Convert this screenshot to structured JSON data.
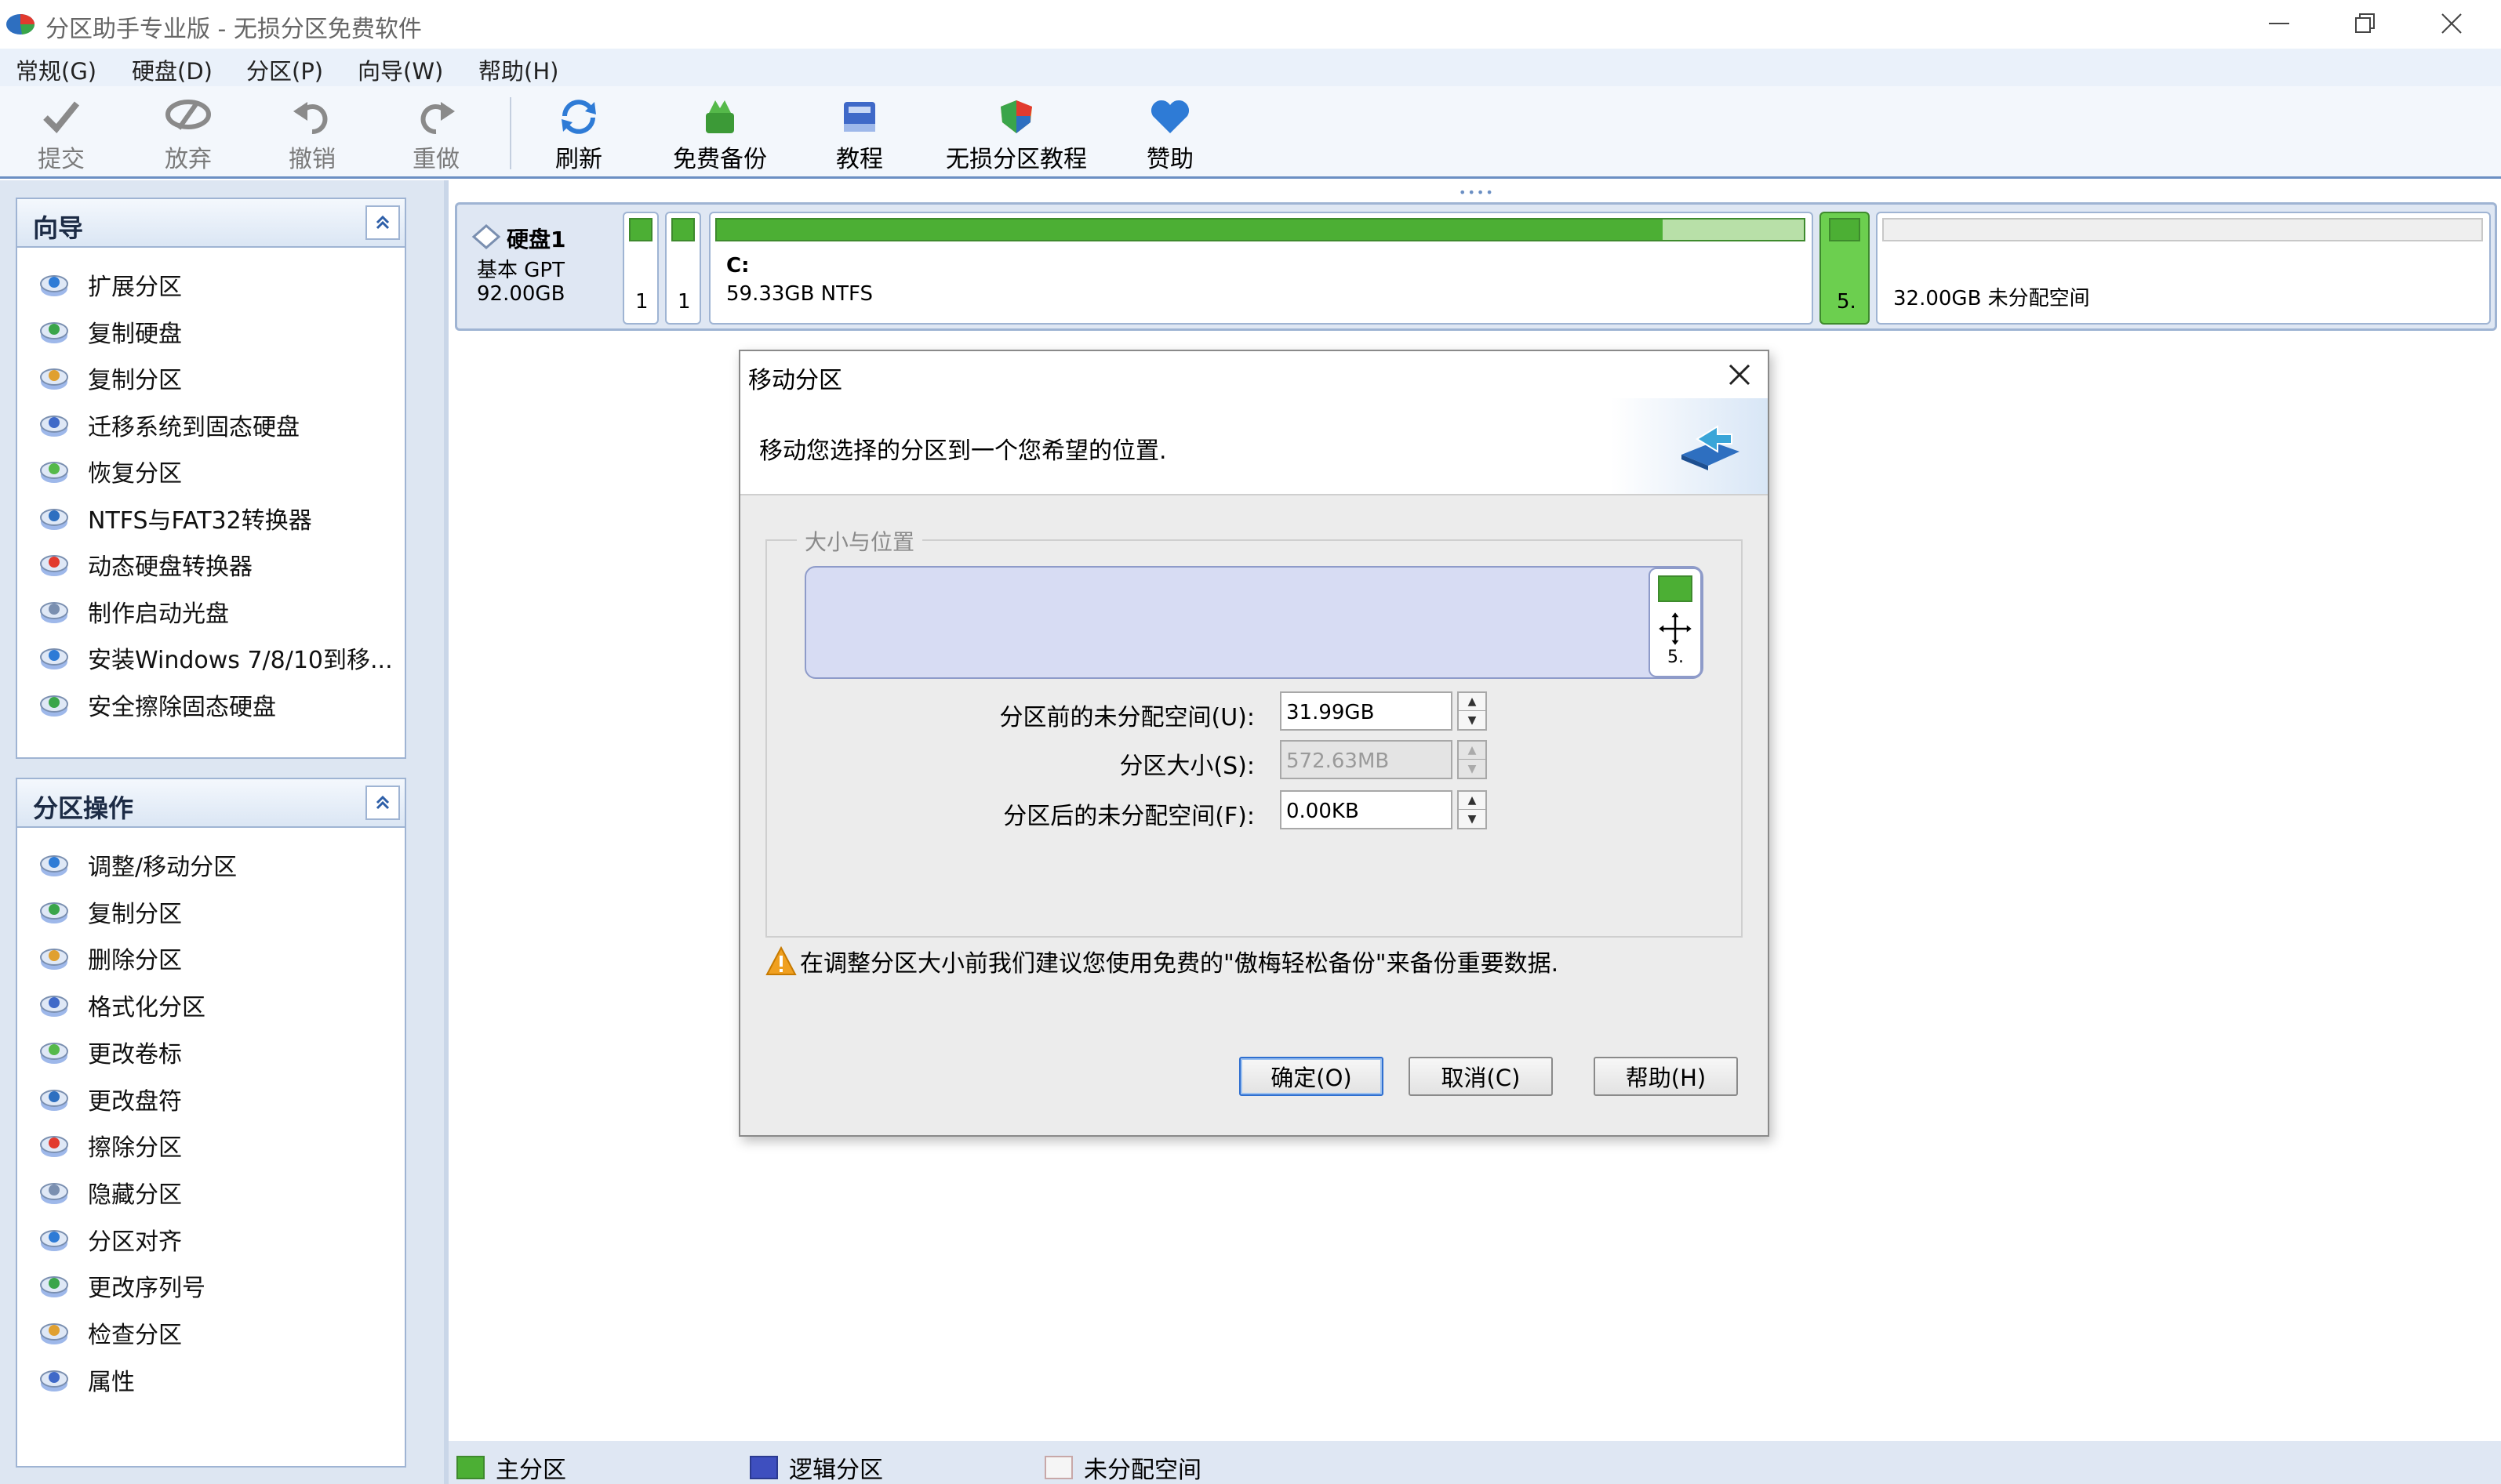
{
  "window": {
    "title": "分区助手专业版 - 无损分区免费软件"
  },
  "menu": {
    "items": [
      "常规(G)",
      "硬盘(D)",
      "分区(P)",
      "向导(W)",
      "帮助(H)"
    ]
  },
  "toolbar": {
    "commit": "提交",
    "discard": "放弃",
    "undo": "撤销",
    "redo": "重做",
    "refresh": "刷新",
    "backup": "免费备份",
    "tutorial": "教程",
    "lossless_tutorial": "无损分区教程",
    "donate": "赞助"
  },
  "wizard_panel": {
    "title": "向导",
    "items": [
      {
        "label": "扩展分区",
        "icon": "extend-partition-icon"
      },
      {
        "label": "复制硬盘",
        "icon": "copy-disk-icon"
      },
      {
        "label": "复制分区",
        "icon": "copy-partition-icon"
      },
      {
        "label": "迁移系统到固态硬盘",
        "icon": "migrate-ssd-icon"
      },
      {
        "label": "恢复分区",
        "icon": "recover-partition-icon"
      },
      {
        "label": "NTFS与FAT32转换器",
        "icon": "ntfs-fat32-icon"
      },
      {
        "label": "动态硬盘转换器",
        "icon": "dynamic-disk-icon"
      },
      {
        "label": "制作启动光盘",
        "icon": "bootable-cd-icon"
      },
      {
        "label": "安装Windows 7/8/10到移...",
        "icon": "windows-to-go-icon"
      },
      {
        "label": "安全擦除固态硬盘",
        "icon": "secure-erase-icon"
      }
    ]
  },
  "partition_panel": {
    "title": "分区操作",
    "items": [
      {
        "label": "调整/移动分区",
        "icon": "resize-move-icon"
      },
      {
        "label": "复制分区",
        "icon": "copy-partition-icon"
      },
      {
        "label": "删除分区",
        "icon": "delete-partition-icon"
      },
      {
        "label": "格式化分区",
        "icon": "format-partition-icon"
      },
      {
        "label": "更改卷标",
        "icon": "change-label-icon"
      },
      {
        "label": "更改盘符",
        "icon": "change-letter-icon"
      },
      {
        "label": "擦除分区",
        "icon": "wipe-partition-icon"
      },
      {
        "label": "隐藏分区",
        "icon": "hide-partition-icon"
      },
      {
        "label": "分区对齐",
        "icon": "align-partition-icon"
      },
      {
        "label": "更改序列号",
        "icon": "change-serial-icon"
      },
      {
        "label": "检查分区",
        "icon": "check-partition-icon"
      },
      {
        "label": "属性",
        "icon": "properties-icon"
      }
    ]
  },
  "disk": {
    "name": "硬盘1",
    "type": "基本 GPT",
    "size": "92.00GB",
    "partitions": [
      {
        "label": "1"
      },
      {
        "label": "1"
      },
      {
        "letter": "C:",
        "info": "59.33GB NTFS",
        "used_fraction": 0.87
      },
      {
        "label": "5."
      },
      {
        "info": "32.00GB 未分配空间"
      }
    ]
  },
  "legend": {
    "primary": "主分区",
    "logical": "逻辑分区",
    "unallocated": "未分配空间"
  },
  "dialog": {
    "title": "移动分区",
    "description": "移动您选择的分区到一个您希望的位置.",
    "group_title": "大小与位置",
    "map_label": "5.",
    "before_label": "分区前的未分配空间(U):",
    "before_value": "31.99GB",
    "size_label": "分区大小(S):",
    "size_value": "572.63MB",
    "after_label": "分区后的未分配空间(F):",
    "after_value": "0.00KB",
    "warning": "在调整分区大小前我们建议您使用免费的\"傲梅轻松备份\"来备份重要数据.",
    "ok": "确定(O)",
    "cancel": "取消(C)",
    "help": "帮助(H)"
  },
  "colors": {
    "primary_partition": "#4caf34",
    "logical_partition": "#3e4fbf",
    "accent_blue": "#6b8fc3"
  }
}
